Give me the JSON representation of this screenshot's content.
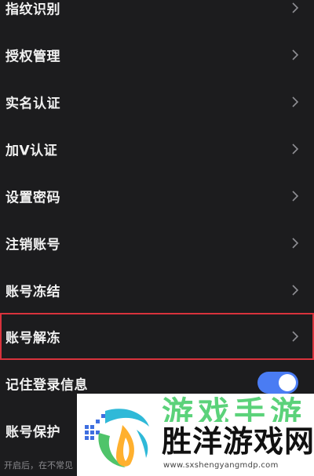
{
  "settings": {
    "items": [
      {
        "label": "指纹识别",
        "icon": "chevron-right-icon"
      },
      {
        "label": "授权管理",
        "icon": "chevron-right-icon"
      },
      {
        "label": "实名认证",
        "icon": "chevron-right-icon"
      },
      {
        "label": "加V认证",
        "icon": "chevron-right-icon"
      },
      {
        "label": "设置密码",
        "icon": "chevron-right-icon"
      },
      {
        "label": "注销账号",
        "icon": "chevron-right-icon"
      },
      {
        "label": "账号冻结",
        "icon": "chevron-right-icon"
      },
      {
        "label": "账号解冻",
        "icon": "chevron-right-icon",
        "highlighted": true
      },
      {
        "label": "记住登录信息",
        "toggle_on": true
      },
      {
        "label": "账号保护"
      }
    ],
    "footnote": "开启后，在不常见"
  },
  "colors": {
    "background": "#1c1c1e",
    "toggle_on": "#4a7cf3",
    "highlight_border": "#d8323c"
  },
  "watermark": {
    "top_text": "游戏手游",
    "title": "胜洋游戏网",
    "url": "www.sxshengyangmdp.com"
  }
}
